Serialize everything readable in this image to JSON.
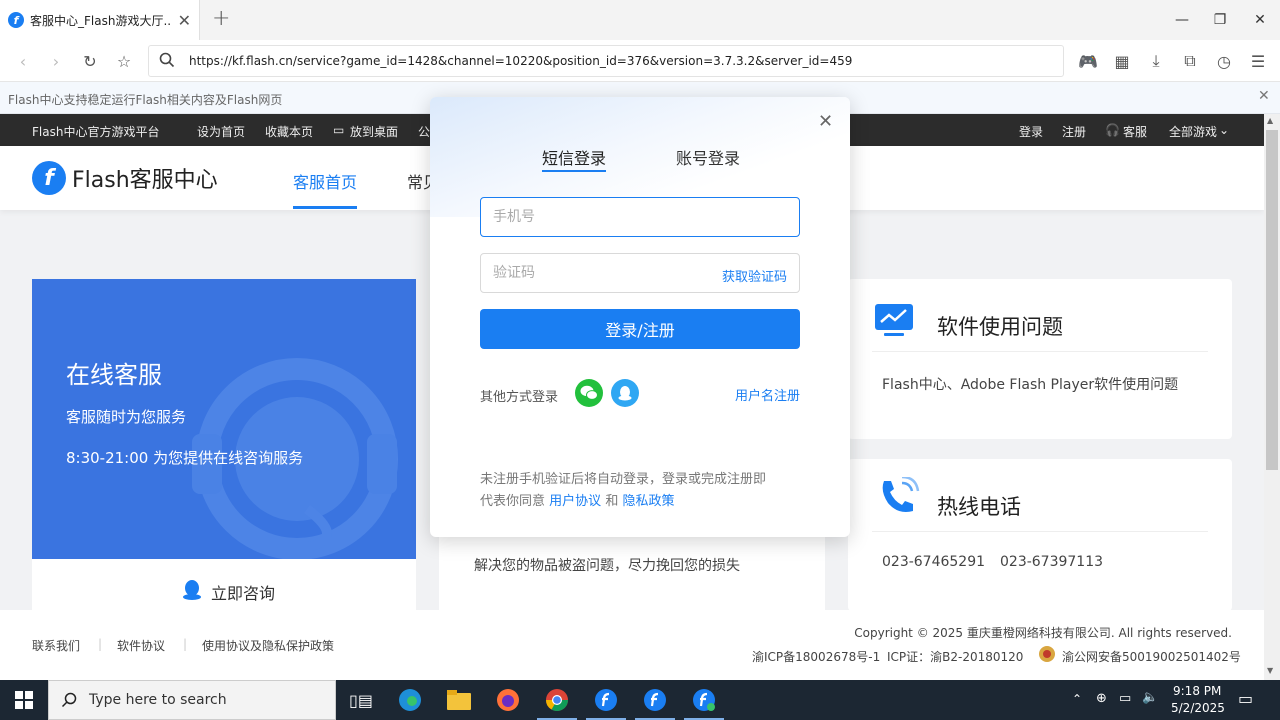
{
  "browser": {
    "tab_title": "客服中心_Flash游戏大厅..",
    "new_tab": "+",
    "url": "https://kf.flash.cn/service?game_id=1428&channel=10220&position_id=376&version=3.7.3.2&server_id=459",
    "info_text": "Flash中心支持稳定运行Flash相关内容及Flash网页"
  },
  "topnav": {
    "platform": "Flash中心官方游戏平台",
    "set_home": "设为首页",
    "bookmark": "收藏本页",
    "desktop": "放到桌面",
    "partial": "公",
    "login": "登录",
    "register": "注册",
    "service": "客服",
    "all_games": "全部游戏"
  },
  "header": {
    "logo_letter": "f",
    "brand": "Flash客服中心",
    "nav_home": "客服首页",
    "nav_partial": "常见"
  },
  "online_card": {
    "title": "在线客服",
    "line1": "客服随时为您服务",
    "line2": "8:30-21:00 为您提供在线咨询服务",
    "consult": "立即咨询"
  },
  "mid_card": {
    "text": "解决您的物品被盗问题，尽力挽回您的损失"
  },
  "software_card": {
    "title": "软件使用问题",
    "desc": "Flash中心、Adobe Flash Player软件使用问题"
  },
  "hotline_card": {
    "title": "热线电话",
    "phone1": "023-67465291",
    "phone2": "023-67397113"
  },
  "footer": {
    "contact": "联系我们",
    "agreement": "软件协议",
    "privacy": "使用协议及隐私保护政策",
    "copyright": "Copyright © 2025 重庆重橙网络科技有限公司. All rights reserved.",
    "icp": "渝ICP备18002678号-1",
    "icp_cert": "ICP证：渝B2-20180120",
    "police": "渝公网安备50019002501402号"
  },
  "modal": {
    "tab_sms": "短信登录",
    "tab_account": "账号登录",
    "phone_placeholder": "手机号",
    "code_placeholder": "验证码",
    "get_code": "获取验证码",
    "submit": "登录/注册",
    "other_methods": "其他方式登录",
    "username_register": "用户名注册",
    "terms_prefix": "未注册手机验证后将自动登录，登录或完成注册即",
    "terms_line2": "代表你同意",
    "user_agreement": "用户协议",
    "and": "和",
    "privacy_policy": "隐私政策"
  },
  "taskbar": {
    "search_placeholder": "Type here to search",
    "time": "9:18 PM",
    "date": "5/2/2025"
  },
  "colors": {
    "accent": "#1a7ef2",
    "online_card": "#3a74e0",
    "topnav": "#2c2c2c"
  }
}
